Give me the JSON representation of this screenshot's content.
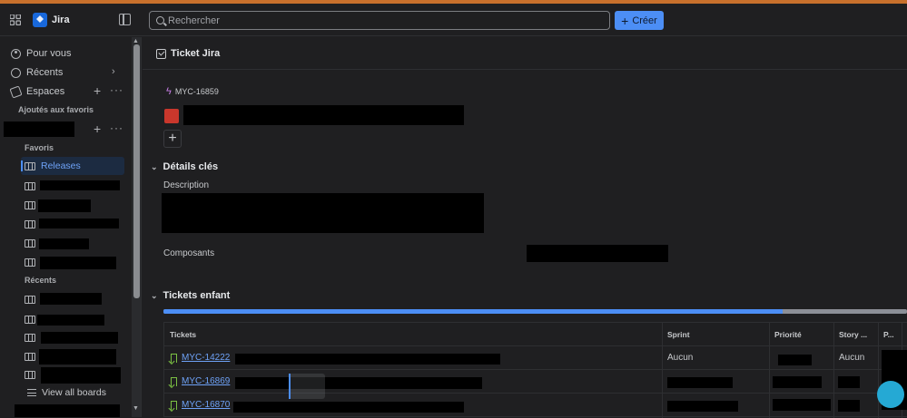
{
  "app": {
    "name": "Jira"
  },
  "topbar": {
    "search_placeholder": "Rechercher",
    "create_label": "Créer"
  },
  "sidebar": {
    "pour_vous": "Pour vous",
    "recents": "Récents",
    "espaces": "Espaces",
    "ajoutes_aux_favoris": "Ajoutés aux favoris",
    "favoris": "Favoris",
    "recents_section": "Récents",
    "active_board": "Releases",
    "view_all_boards": "View all boards"
  },
  "main": {
    "header_title": "Ticket Jira",
    "issue_key": "MYC-16859",
    "details_title": "Détails clés",
    "description_label": "Description",
    "composants_label": "Composants",
    "child_tickets_title": "Tickets enfant",
    "progress_done_fraction": 0.833
  },
  "table": {
    "headers": {
      "tickets": "Tickets",
      "sprint": "Sprint",
      "priorite": "Priorité",
      "story": "Story ...",
      "p": "P..."
    },
    "rows": [
      {
        "key": "MYC-14222",
        "sprint": "Aucun",
        "story": "Aucun"
      },
      {
        "key": "MYC-16869",
        "sprint": "",
        "story": ""
      },
      {
        "key": "MYC-16870",
        "sprint": "",
        "story": ""
      }
    ]
  },
  "colors": {
    "accent": "#4c8ef5",
    "brand": "#1868db",
    "status_red": "#c9372c",
    "story_icon": "#7bc043"
  }
}
